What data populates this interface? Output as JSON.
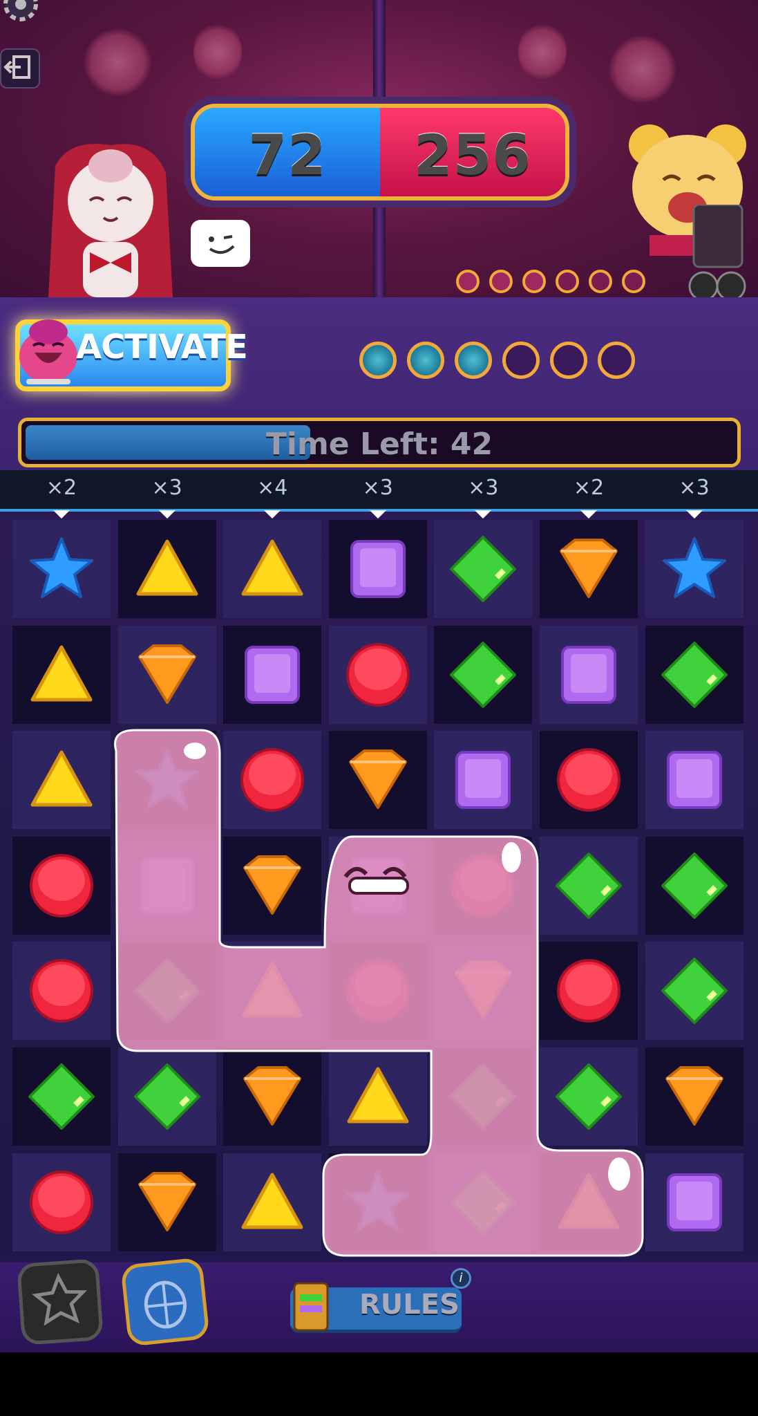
{
  "scores": {
    "player": "72",
    "opponent": "256"
  },
  "activate": {
    "label": "ACTIVATE",
    "charge_filled": 3,
    "charge_total": 6
  },
  "opponent_charge": {
    "filled": 3,
    "total": 6
  },
  "timer": {
    "label": "Time Left: 42",
    "fraction_remaining": 0.4
  },
  "multipliers": [
    "×2",
    "×3",
    "×4",
    "×3",
    "×3",
    "×2",
    "×3"
  ],
  "board": {
    "rows": [
      [
        "star-blue",
        "triangle-yellow",
        "triangle-yellow",
        "square-purple",
        "diamond-green",
        "shield-orange",
        "star-blue"
      ],
      [
        "triangle-yellow",
        "shield-orange",
        "square-purple",
        "circle-red",
        "diamond-green",
        "square-purple",
        "diamond-green"
      ],
      [
        "triangle-yellow",
        "star-blue",
        "circle-red",
        "shield-orange",
        "square-purple",
        "circle-red",
        "square-purple"
      ],
      [
        "circle-red",
        "square-purple",
        "shield-orange",
        "square-purple",
        "circle-red",
        "diamond-green",
        "diamond-green"
      ],
      [
        "circle-red",
        "diamond-green",
        "triangle-yellow",
        "circle-red",
        "shield-orange",
        "circle-red",
        "diamond-green"
      ],
      [
        "diamond-green",
        "diamond-green",
        "shield-orange",
        "triangle-yellow",
        "diamond-green",
        "diamond-green",
        "shield-orange"
      ],
      [
        "circle-red",
        "shield-orange",
        "triangle-yellow",
        "star-blue",
        "diamond-green",
        "triangle-yellow",
        "square-purple"
      ]
    ],
    "checker_dark": [
      [
        false,
        true,
        false,
        true,
        false,
        true,
        false
      ],
      [
        true,
        false,
        true,
        false,
        true,
        false,
        true
      ],
      [
        false,
        true,
        false,
        true,
        false,
        true,
        false
      ],
      [
        true,
        false,
        true,
        false,
        true,
        false,
        true
      ],
      [
        false,
        true,
        false,
        true,
        false,
        true,
        false
      ],
      [
        true,
        false,
        true,
        false,
        true,
        false,
        true
      ],
      [
        false,
        true,
        false,
        true,
        false,
        true,
        false
      ]
    ],
    "slimed": [
      [
        2,
        1
      ],
      [
        3,
        1
      ],
      [
        4,
        1
      ],
      [
        4,
        2
      ],
      [
        3,
        3
      ],
      [
        4,
        3
      ],
      [
        3,
        4
      ],
      [
        4,
        4
      ],
      [
        5,
        4
      ],
      [
        6,
        3
      ],
      [
        6,
        4
      ],
      [
        6,
        5
      ]
    ]
  },
  "colors": {
    "star-blue": "#2e9dff",
    "triangle-yellow": "#ffd91a",
    "square-purple": "#b06af0",
    "diamond-green": "#3fd23a",
    "shield-orange": "#ff9a1e",
    "circle-red": "#f0263e",
    "slime": "#f49ac6",
    "accent-gold": "#f0b43a"
  },
  "buttons": {
    "rules_label": "RULES",
    "info_glyph": "i"
  }
}
